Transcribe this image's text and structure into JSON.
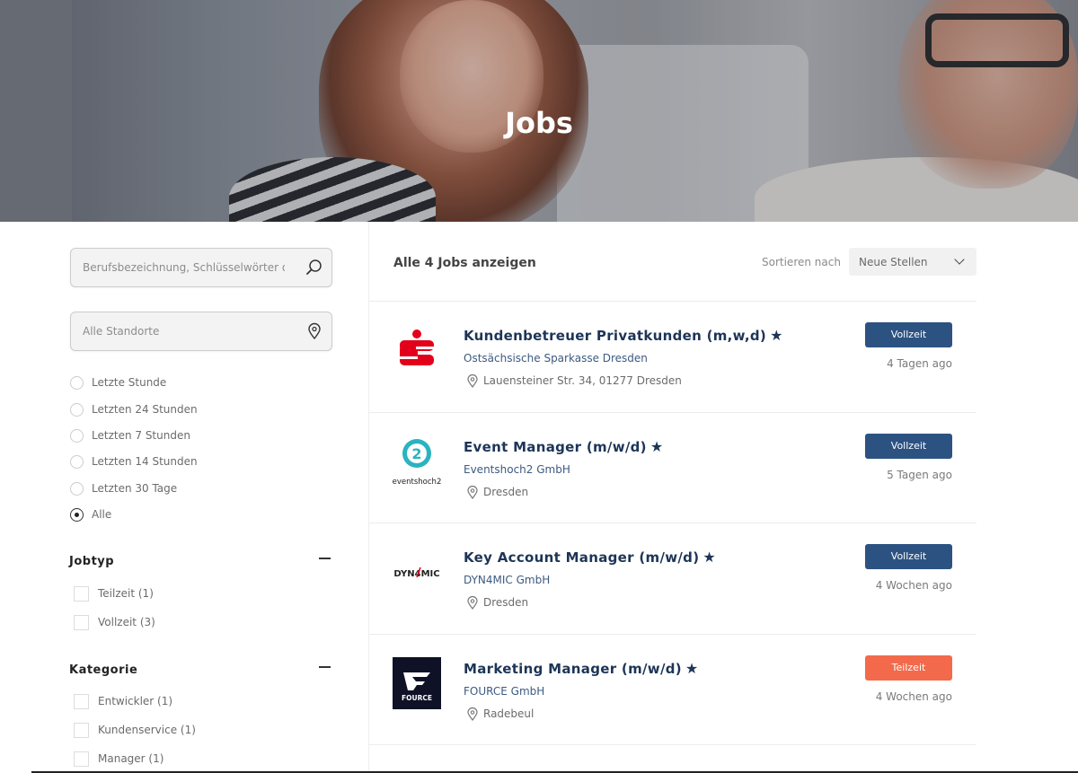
{
  "hero": {
    "title": "Jobs"
  },
  "sidebar": {
    "search": {
      "placeholder": "Berufsbezeichnung, Schlüsselwörter oder Firma"
    },
    "location": {
      "placeholder": "Alle Standorte"
    },
    "date_filters": [
      {
        "label": "Letzte Stunde",
        "selected": false
      },
      {
        "label": "Letzten 24 Stunden",
        "selected": false
      },
      {
        "label": "Letzten 7 Stunden",
        "selected": false
      },
      {
        "label": "Letzten 14 Stunden",
        "selected": false
      },
      {
        "label": "Letzten 30 Tage",
        "selected": false
      },
      {
        "label": "Alle",
        "selected": true
      }
    ],
    "jobtyp": {
      "title": "Jobtyp",
      "items": [
        {
          "label": "Teilzeit (1)"
        },
        {
          "label": "Vollzeit (3)"
        }
      ]
    },
    "kategorie": {
      "title": "Kategorie",
      "items": [
        {
          "label": "Entwickler (1)"
        },
        {
          "label": "Kundenservice (1)"
        },
        {
          "label": "Manager (1)"
        }
      ]
    }
  },
  "main": {
    "count_label": "Alle 4 Jobs anzeigen",
    "sort_label": "Sortieren nach",
    "sort_value": "Neue Stellen",
    "jobs": [
      {
        "title": "Kundenbetreuer Privatkunden (m,w,d)",
        "company": "Ostsächsische Sparkasse Dresden",
        "location": "Lauensteiner Str. 34, 01277 Dresden",
        "type": "Vollzeit",
        "age": "4 Tagen ago",
        "type_color": "#2c5282",
        "logo": "sparkasse-logo"
      },
      {
        "title": "Event Manager (m/w/d)",
        "company": "Eventshoch2 GmbH",
        "location": "Dresden",
        "type": "Vollzeit",
        "age": "5 Tagen ago",
        "type_color": "#2c5282",
        "logo": "eventshoch2-logo",
        "logo_text": "eventshoch2"
      },
      {
        "title": "Key Account Manager (m/w/d)",
        "company": "DYN4MIC GmbH",
        "location": "Dresden",
        "type": "Vollzeit",
        "age": "4 Wochen ago",
        "type_color": "#2c5282",
        "logo": "dyn4mic-logo",
        "logo_text": "DYN4MIC"
      },
      {
        "title": "Marketing Manager (m/w/d)",
        "company": "FOURCE GmbH",
        "location": "Radebeul",
        "type": "Teilzeit",
        "age": "4 Wochen ago",
        "type_color": "#f26a4b",
        "logo": "fource-logo",
        "logo_text": "FOURCE"
      }
    ]
  },
  "colors": {
    "title_navy": "#1d3557",
    "vollzeit": "#2c5282",
    "teilzeit": "#f26a4b",
    "sparkasse_red": "#e3001b",
    "eventshoch_teal": "#2ab3c0"
  }
}
